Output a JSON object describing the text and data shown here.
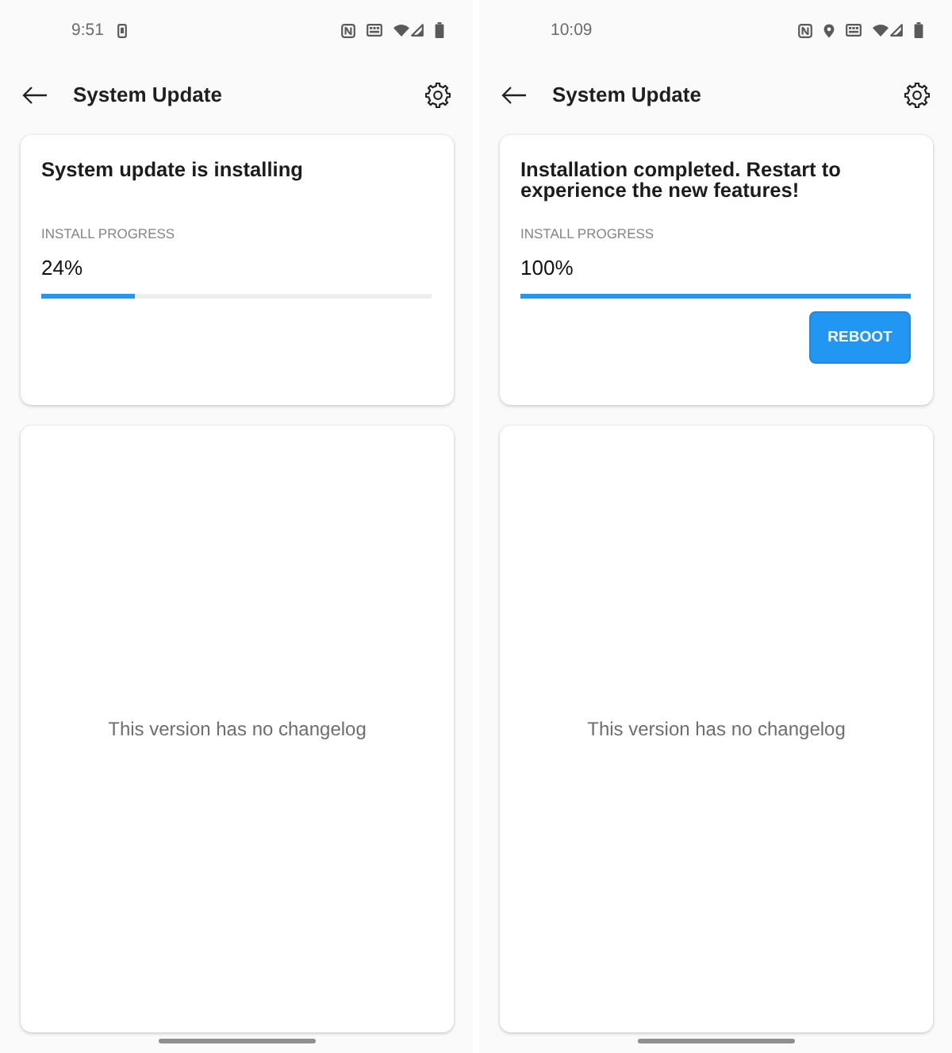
{
  "screens": [
    {
      "status_bar": {
        "time": "9:51",
        "notification_icons": [
          {
            "kind": "phone"
          }
        ],
        "status_icons": [
          {
            "kind": "nfc"
          },
          {
            "kind": "keyboard"
          },
          {
            "kind": "wifi"
          },
          {
            "kind": "signal"
          },
          {
            "kind": "battery"
          }
        ]
      },
      "toolbar": {
        "title": "System Update"
      },
      "update_card": {
        "title": "System update is installing",
        "progress_label": "INSTALL PROGRESS",
        "percent": "24%",
        "level": 0.24
      },
      "changelog": {
        "text": "This version has no changelog"
      }
    },
    {
      "status_bar": {
        "time": "10:09",
        "status_icons": [
          {
            "kind": "nfc"
          },
          {
            "kind": "location"
          },
          {
            "kind": "keyboard"
          },
          {
            "kind": "wifi"
          },
          {
            "kind": "signal"
          },
          {
            "kind": "battery"
          }
        ]
      },
      "toolbar": {
        "title": "System Update"
      },
      "update_card": {
        "title": "Installation completed. Restart to experience the new features!",
        "progress_label": "INSTALL PROGRESS",
        "percent": "100%",
        "level": 1,
        "button": {
          "label": "REBOOT"
        }
      },
      "changelog": {
        "text": "This version has no changelog"
      }
    }
  ]
}
